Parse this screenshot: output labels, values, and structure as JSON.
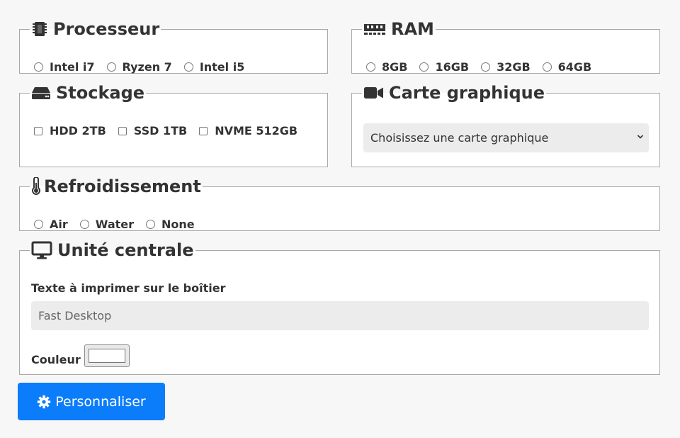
{
  "processeur": {
    "title": "Processeur",
    "icon": "cpu-chip-icon",
    "options": [
      "Intel i7",
      "Ryzen 7",
      "Intel i5"
    ]
  },
  "ram": {
    "title": "RAM",
    "icon": "memory-icon",
    "options": [
      "8GB",
      "16GB",
      "32GB",
      "64GB"
    ]
  },
  "stockage": {
    "title": "Stockage",
    "icon": "hdd-icon",
    "options": [
      "HDD 2TB",
      "SSD 1TB",
      "NVME 512GB"
    ]
  },
  "carte_graphique": {
    "title": "Carte graphique",
    "icon": "video-camera-icon",
    "select_value": "Choisissez une carte graphique"
  },
  "refroidissement": {
    "title": "Refroidissement",
    "icon": "thermometer-icon",
    "options": [
      "Air",
      "Water",
      "None"
    ]
  },
  "unite_centrale": {
    "title": "Unité centrale",
    "icon": "desktop-icon",
    "text_label": "Texte à imprimer sur le boîtier",
    "text_placeholder": "Fast Desktop",
    "color_label": "Couleur",
    "color_value": "#ffffff"
  },
  "submit": {
    "label": "Personnaliser",
    "icon": "gear-icon",
    "color": "#0b7dfa"
  }
}
